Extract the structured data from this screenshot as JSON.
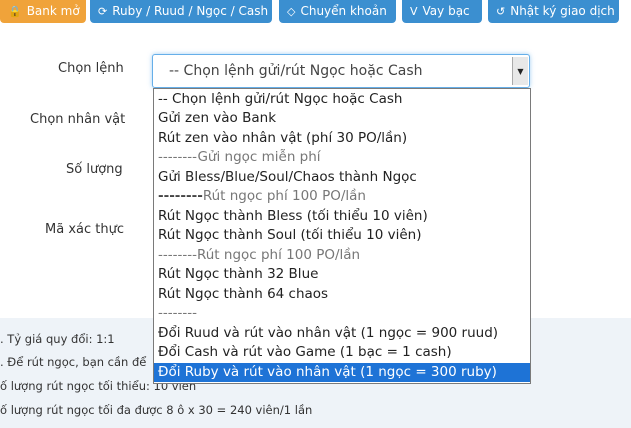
{
  "tabs": [
    {
      "icon": "bank-icon",
      "glyph": "🔒",
      "label": "Bank mở",
      "color": "#f0a33a"
    },
    {
      "icon": "refresh-icon",
      "glyph": "⟳",
      "label": "Ruby / Ruud / Ngọc / Cash",
      "color": "#3b8fd0"
    },
    {
      "icon": "exchange-icon",
      "glyph": "◇",
      "label": "Chuyển khoản",
      "color": "#3b8fd0"
    },
    {
      "icon": "vay-icon",
      "glyph": "V",
      "label": "Vay bạc",
      "color": "#3b8fd0"
    },
    {
      "icon": "history-icon",
      "glyph": "↺",
      "label": "Nhật ký giao dịch",
      "color": "#3b8fd0"
    }
  ],
  "form": {
    "command_label": "Chọn lệnh",
    "character_label": "Chọn nhân vật",
    "quantity_label": "Số lượng",
    "captcha_label": "Mã xác thực",
    "command_selected": "-- Chọn lệnh gửi/rút Ngọc hoặc Cash"
  },
  "dropdown": {
    "options": [
      {
        "text": "-- Chọn lệnh gửi/rút Ngọc hoặc Cash",
        "kind": "option"
      },
      {
        "text": "Gửi zen vào Bank",
        "kind": "option"
      },
      {
        "text": "Rút zen vào nhân vật (phí 30 PO/lần)",
        "kind": "option"
      },
      {
        "text": "--------Gửi ngọc miễn phí",
        "kind": "group"
      },
      {
        "text": "Gửi Bless/Blue/Soul/Chaos thành Ngọc",
        "kind": "option"
      },
      {
        "text": "--------Rút ngọc phí 100 PO/lần",
        "kind": "group-bold"
      },
      {
        "text": "Rút Ngọc thành Bless (tối thiểu 10 viên)",
        "kind": "option"
      },
      {
        "text": "Rút Ngọc thành Soul (tối thiểu 10 viên)",
        "kind": "option"
      },
      {
        "text": "--------Rút ngọc phí 100 PO/lần",
        "kind": "group"
      },
      {
        "text": "Rút Ngọc thành 32 Blue",
        "kind": "option"
      },
      {
        "text": "Rút Ngọc thành 64 chaos",
        "kind": "option"
      },
      {
        "text": "--------",
        "kind": "group"
      },
      {
        "text": "Đổi Ruud và rút vào nhân vật (1 ngọc = 900 ruud)",
        "kind": "option"
      },
      {
        "text": "Đổi Cash và rút vào Game (1 bạc = 1 cash)",
        "kind": "option"
      },
      {
        "text": "Đổi Ruby và rút vào nhân vật (1 ngọc = 300 ruby)",
        "kind": "selected"
      }
    ]
  },
  "info": {
    "line1": ". Tỷ giá quy đổi: 1:1",
    "line2": ". Để rút ngọc, bạn cần để",
    "line3": "ố lượng rút ngọc tối thiểu: 10 viên",
    "line4": "ố lượng rút ngọc tối đa được 8 ô x 30 = 240 viên/1 lần"
  }
}
